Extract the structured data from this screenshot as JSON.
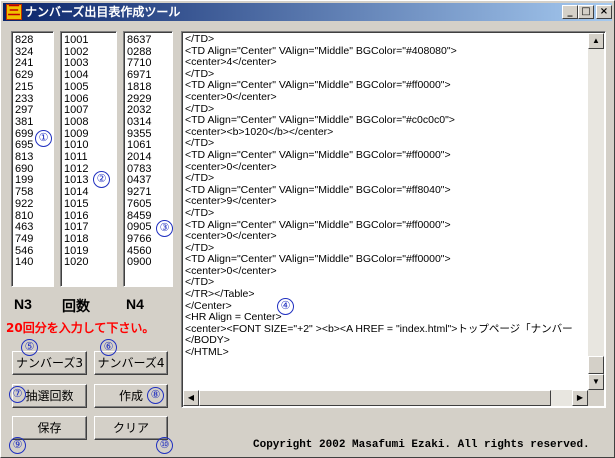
{
  "window": {
    "title": "ナンバーズ出目表作成ツール",
    "icon_char": "三",
    "controls": {
      "minimize": "_",
      "maximize": "□",
      "close": "×"
    }
  },
  "lists": {
    "n3": [
      "828",
      "324",
      "241",
      "629",
      "215",
      "233",
      "297",
      "381",
      "699",
      "695",
      "813",
      "690",
      "199",
      "758",
      "922",
      "810",
      "463",
      "749",
      "546",
      "140"
    ],
    "draws": [
      "1001",
      "1002",
      "1003",
      "1004",
      "1005",
      "1006",
      "1007",
      "1008",
      "1009",
      "1010",
      "1011",
      "1012",
      "1013",
      "1014",
      "1015",
      "1016",
      "1017",
      "1018",
      "1019",
      "1020"
    ],
    "n4": [
      "8637",
      "0288",
      "7710",
      "6971",
      "1818",
      "2929",
      "2032",
      "0314",
      "9355",
      "1061",
      "2014",
      "0783",
      "0437",
      "9271",
      "7605",
      "8459",
      "0905",
      "9766",
      "4560",
      "0900"
    ]
  },
  "labels": {
    "n3": "N3",
    "draws": "回数",
    "n4": "N4",
    "warning": "20回分を入力して下さい。"
  },
  "markers": [
    "①",
    "②",
    "③",
    "④",
    "⑤",
    "⑥",
    "⑦",
    "⑧",
    "⑨",
    "⑩"
  ],
  "buttons": {
    "numbers3": "ナンバーズ3",
    "numbers4": "ナンバーズ4",
    "draw_count": "抽選回数",
    "create": "作成",
    "save": "保存",
    "clear": "クリア"
  },
  "code_lines": [
    "</TD>",
    "<TD Align=\"Center\" VAlign=\"Middle\" BGColor=\"#408080\">",
    "<center>4</center>",
    "</TD>",
    "<TD Align=\"Center\" VAlign=\"Middle\" BGColor=\"#ff0000\">",
    "<center>0</center>",
    "</TD>",
    "<TD Align=\"Center\" VAlign=\"Middle\" BGColor=\"#c0c0c0\">",
    "<center><b>1020</b></center>",
    "</TD>",
    "<TD Align=\"Center\" VAlign=\"Middle\" BGColor=\"#ff0000\">",
    "<center>0</center>",
    "</TD>",
    "<TD Align=\"Center\" VAlign=\"Middle\" BGColor=\"#ff8040\">",
    "<center>9</center>",
    "</TD>",
    "<TD Align=\"Center\" VAlign=\"Middle\" BGColor=\"#ff0000\">",
    "<center>0</center>",
    "</TD>",
    "<TD Align=\"Center\" VAlign=\"Middle\" BGColor=\"#ff0000\">",
    "<center>0</center>",
    "</TD>",
    "</TR></Table>",
    "</Center>",
    "<HR Align = Center>",
    "<center><FONT SIZE=\"+2\" ><b><A HREF = \"index.html\">トップページ「ナンバー",
    "</BODY>",
    "</HTML>"
  ],
  "footer": {
    "copyright": "Copyright 2002 Masafumi Ezaki. All rights reserved."
  },
  "colors": {
    "marker": "#2030c0",
    "warning": "#ff0000",
    "titlebar_start": "#0a246a",
    "titlebar_end": "#a6caf0"
  }
}
